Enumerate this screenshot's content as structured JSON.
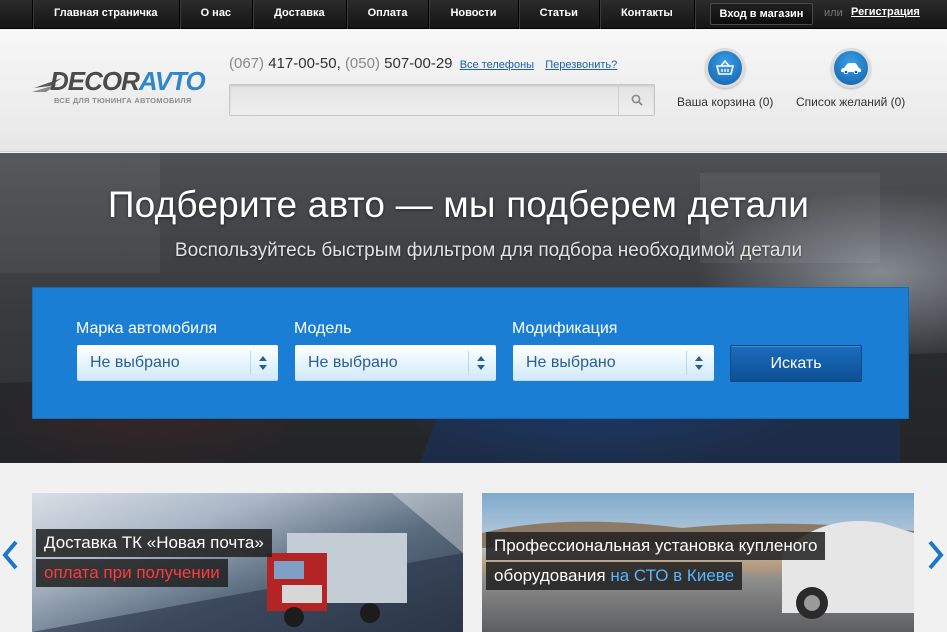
{
  "topnav": {
    "items": [
      "Главная страничка",
      "О нас",
      "Доставка",
      "Оплата",
      "Новости",
      "Статьи",
      "Контакты"
    ],
    "login_label": "Вход в магазин",
    "or_text": "или",
    "register_label": "Регистрация"
  },
  "header": {
    "logo_part1": "DECOR",
    "logo_part2": "AVTO",
    "logo_tagline": "ВСЕ ДЛЯ ТЮНИНГА АВТОМОБИЛЯ",
    "phone1_code": "(067)",
    "phone1_number": "417-00-50,",
    "phone2_code": "(050)",
    "phone2_number": "507-00-29",
    "all_phones_link": "Все телефоны",
    "callback_link": "Перезвонить?",
    "search_placeholder": "",
    "cart_label": "Ваша корзина (0)",
    "wishlist_label": "Список желаний (0)",
    "accent_color": "#1a7fd4"
  },
  "hero": {
    "title": "Подберите авто — мы подберем детали",
    "subtitle": "Воспользуйтесь быстрым фильтром для подбора необходимой детали",
    "filter": {
      "make_label": "Марка автомобиля",
      "make_value": "Не выбрано",
      "model_label": "Модель",
      "model_value": "Не выбрано",
      "mod_label": "Модификация",
      "mod_value": "Не выбрано",
      "search_button": "Искать"
    }
  },
  "promos": {
    "banner1_line1": "Доставка ТК «Новая почта»",
    "banner1_line2": "оплата при получении",
    "banner2_line1": "Профессиональная установка купленого",
    "banner2_line2_prefix": "оборудования ",
    "banner2_line2_highlight": "на СТО в Киеве"
  }
}
